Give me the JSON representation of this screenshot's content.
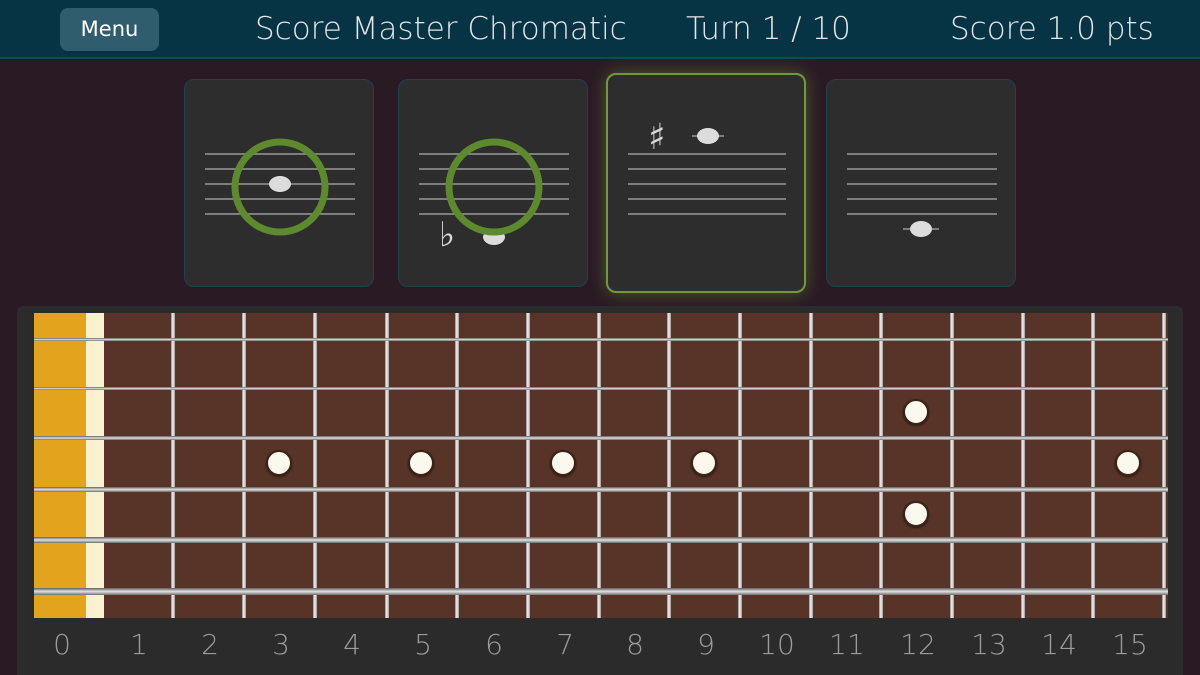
{
  "header": {
    "menu_label": "Menu",
    "title": "Score Master Chromatic",
    "turn": "Turn 1 / 10",
    "score": "Score 1.0 pts"
  },
  "cards": [
    {
      "state": "marked-correct",
      "accidental": "",
      "clef_note": "B4"
    },
    {
      "state": "marked-correct",
      "accidental": "♭",
      "clef_note": "C4-flat"
    },
    {
      "state": "selected",
      "accidental": "♯",
      "clef_note": "C6-sharp"
    },
    {
      "state": "unanswered",
      "accidental": "",
      "clef_note": "A3"
    }
  ],
  "fretboard": {
    "fret_numbers": [
      "0",
      "1",
      "2",
      "3",
      "4",
      "5",
      "6",
      "7",
      "8",
      "9",
      "10",
      "11",
      "12",
      "13",
      "14",
      "15"
    ],
    "inlay_single_frets": [
      3,
      5,
      7,
      9,
      15
    ],
    "inlay_double_frets": [
      12
    ],
    "strings": 6,
    "colors": {
      "nut_zone": "#e3a31c",
      "neck": "#573427",
      "header": "#063444",
      "selected_card_border": "#6f9a3c",
      "marked_ring": "#5e8a2e"
    }
  }
}
